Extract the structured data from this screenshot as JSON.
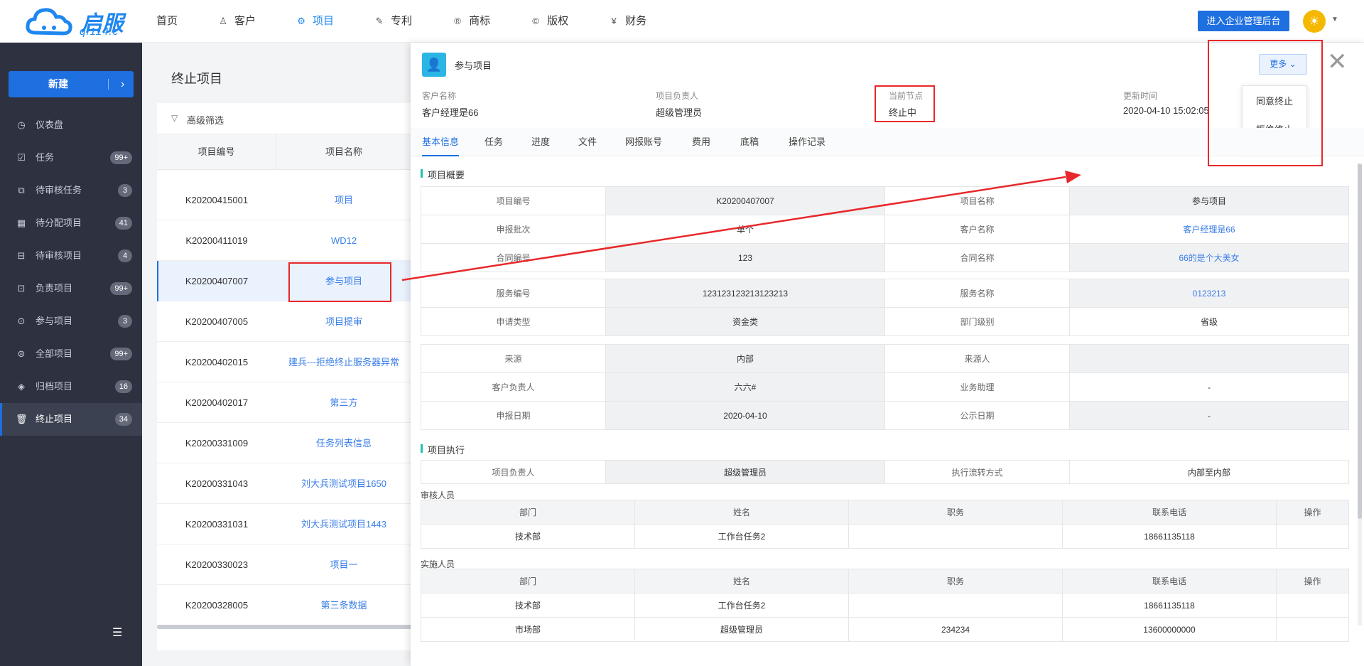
{
  "brand": {
    "logo_text": "启服",
    "logo_sub": "qf114.c"
  },
  "nav": [
    {
      "label": "首页",
      "icon": ""
    },
    {
      "label": "客户",
      "icon": "user-icon"
    },
    {
      "label": "项目",
      "icon": "project-icon"
    },
    {
      "label": "专利",
      "icon": "patent-icon"
    },
    {
      "label": "商标",
      "icon": "trademark-icon"
    },
    {
      "label": "版权",
      "icon": "copyright-icon"
    },
    {
      "label": "财务",
      "icon": "finance-icon"
    }
  ],
  "nav_active": "项目",
  "admin_button": "进入企业管理后台",
  "sidebar": {
    "new_button": "新建",
    "items": [
      {
        "label": "仪表盘",
        "badge": ""
      },
      {
        "label": "任务",
        "badge": "99+"
      },
      {
        "label": "待审核任务",
        "badge": "3"
      },
      {
        "label": "待分配项目",
        "badge": "41"
      },
      {
        "label": "待审核项目",
        "badge": "4"
      },
      {
        "label": "负责项目",
        "badge": "99+"
      },
      {
        "label": "参与项目",
        "badge": "3"
      },
      {
        "label": "全部项目",
        "badge": "99+"
      },
      {
        "label": "归档项目",
        "badge": "16"
      },
      {
        "label": "终止项目",
        "badge": "34"
      }
    ]
  },
  "list": {
    "title": "终止项目",
    "filter_label": "高级筛选",
    "columns": [
      "项目编号",
      "项目名称"
    ],
    "rows": [
      {
        "code": "K20200415001",
        "name": "项目"
      },
      {
        "code": "K20200411019",
        "name": "WD12"
      },
      {
        "code": "K20200407007",
        "name": "参与项目"
      },
      {
        "code": "K20200407005",
        "name": "项目提审"
      },
      {
        "code": "K20200402015",
        "name": "建兵---拒绝终止服务器异常"
      },
      {
        "code": "K20200402017",
        "name": "第三方"
      },
      {
        "code": "K20200331009",
        "name": "任务列表信息"
      },
      {
        "code": "K20200331043",
        "name": "刘大兵测试项目1650"
      },
      {
        "code": "K20200331031",
        "name": "刘大兵测试项目1443"
      },
      {
        "code": "K20200330023",
        "name": "项目一"
      },
      {
        "code": "K20200328005",
        "name": "第三条数据"
      }
    ]
  },
  "detail": {
    "title": "参与项目",
    "more_button": "更多",
    "menu": [
      "同意终止",
      "拒绝终止"
    ],
    "meta": [
      {
        "label": "客户名称",
        "value": "客户经理是66"
      },
      {
        "label": "项目负责人",
        "value": "超级管理员"
      },
      {
        "label": "当前节点",
        "value": "终止中"
      },
      {
        "label": "更新时间",
        "value": "2020-04-10 15:02:05"
      }
    ],
    "tabs": [
      "基本信息",
      "任务",
      "进度",
      "文件",
      "网报账号",
      "费用",
      "底稿",
      "操作记录"
    ],
    "overview_title": "项目概要",
    "group1": [
      [
        "项目编号",
        "K20200407007",
        "项目名称",
        "参与项目"
      ],
      [
        "申报批次",
        "单个",
        "客户名称",
        "客户经理是66"
      ],
      [
        "合同编号",
        "123",
        "合同名称",
        "66的是个大美女"
      ]
    ],
    "group2": [
      [
        "服务编号",
        "123123123213123213",
        "服务名称",
        "0123213"
      ],
      [
        "申请类型",
        "资金类",
        "部门级别",
        "省级"
      ]
    ],
    "group3": [
      [
        "来源",
        "内部",
        "来源人",
        ""
      ],
      [
        "客户负责人",
        "六六#",
        "业务助理",
        "-"
      ],
      [
        "申报日期",
        "2020-04-10",
        "公示日期",
        "-"
      ]
    ],
    "exec_title": "项目执行",
    "exec_row": [
      "项目负责人",
      "超级管理员",
      "执行流转方式",
      "内部至内部"
    ],
    "reviewers_label": "审核人员",
    "people_columns": [
      "部门",
      "姓名",
      "职务",
      "联系电话",
      "操作"
    ],
    "reviewers": [
      [
        "技术部",
        "工作台任务2",
        "",
        "18661135118",
        ""
      ]
    ],
    "implementers_label": "实施人员",
    "implementers": [
      [
        "技术部",
        "工作台任务2",
        "",
        "18661135118",
        ""
      ],
      [
        "市场部",
        "超级管理员",
        "234234",
        "13600000000",
        ""
      ]
    ]
  }
}
